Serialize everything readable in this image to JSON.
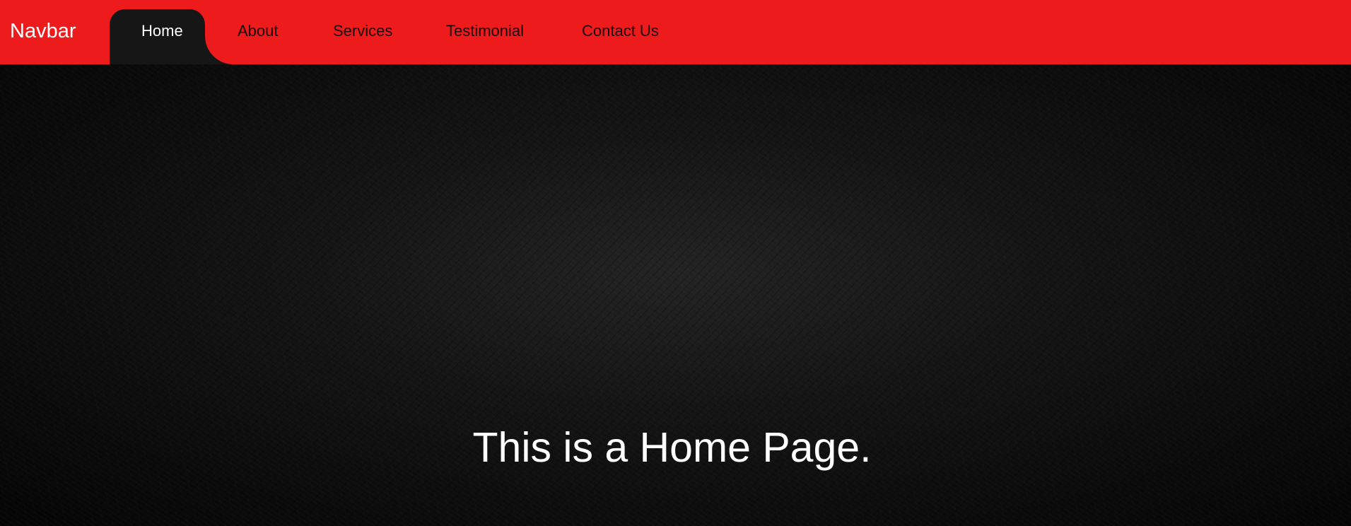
{
  "navbar": {
    "brand": "Navbar",
    "background_color": "#ee1b1c",
    "active_tab_color": "#161616",
    "links": [
      {
        "label": "Home",
        "active": true
      },
      {
        "label": "About",
        "active": false
      },
      {
        "label": "Services",
        "active": false
      },
      {
        "label": "Testimonial",
        "active": false
      },
      {
        "label": "Contact Us",
        "active": false
      }
    ]
  },
  "hero": {
    "title": "This is a Home Page."
  }
}
